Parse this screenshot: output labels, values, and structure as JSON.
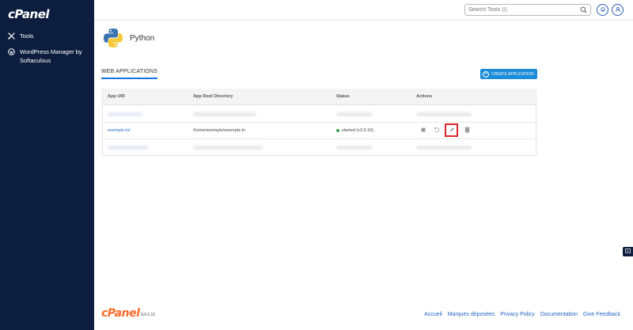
{
  "brand": {
    "logo_text": "cPanel",
    "version": "110.0.10"
  },
  "sidebar": {
    "items": [
      {
        "label": "Tools",
        "icon": "tools-icon"
      },
      {
        "label": "WordPress Manager by Softaculous",
        "icon": "wordpress-icon"
      }
    ]
  },
  "topbar": {
    "search_placeholder": "Search Tools (/)"
  },
  "page": {
    "title": "Python"
  },
  "tabs": {
    "web_applications": "WEB APPLICATIONS"
  },
  "buttons": {
    "create_application": "CREATE APPLICATION"
  },
  "table": {
    "headers": [
      "App URI",
      "App Root Directory",
      "Status",
      "Actions"
    ],
    "visible_row": {
      "uri": "exemple.tn/",
      "root": "/home/exemple/exemple.tn",
      "status": "started (v3.9.16)"
    }
  },
  "footer": {
    "links": [
      "Accueil",
      "Marques déposées",
      "Privacy Policy",
      "Documentation",
      "Give Feedback"
    ]
  },
  "colors": {
    "sidebar_bg": "#0c1d3d",
    "accent": "#1a8cd8",
    "status_started": "#3ea04a",
    "highlight": "#d9262b",
    "brand_orange": "#ff6c2c"
  }
}
